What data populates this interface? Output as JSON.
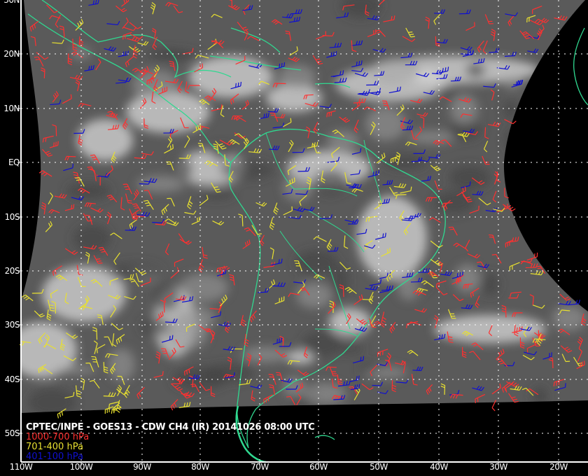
{
  "title": "CPTEC/INPE - GOES13 - CDW CH4 (IR) 20141026 08:00 UTC",
  "legend": [
    {
      "label": "1000-700 hPa",
      "color": "#ff3030"
    },
    {
      "label": "701-400 hPa",
      "color": "#e8e030"
    },
    {
      "label": "401-100 hPa",
      "color": "#1010d0"
    }
  ],
  "lat_labels": [
    "30N",
    "20N",
    "10N",
    "EQ",
    "10S",
    "20S",
    "30S",
    "40S",
    "50S"
  ],
  "lon_labels": [
    "110W",
    "100W",
    "90W",
    "80W",
    "70W",
    "60W",
    "50W",
    "40W",
    "30W",
    "20W"
  ],
  "colors": {
    "coast": "#30d890",
    "grid": "#ffffff",
    "axis": "#ffffff"
  }
}
